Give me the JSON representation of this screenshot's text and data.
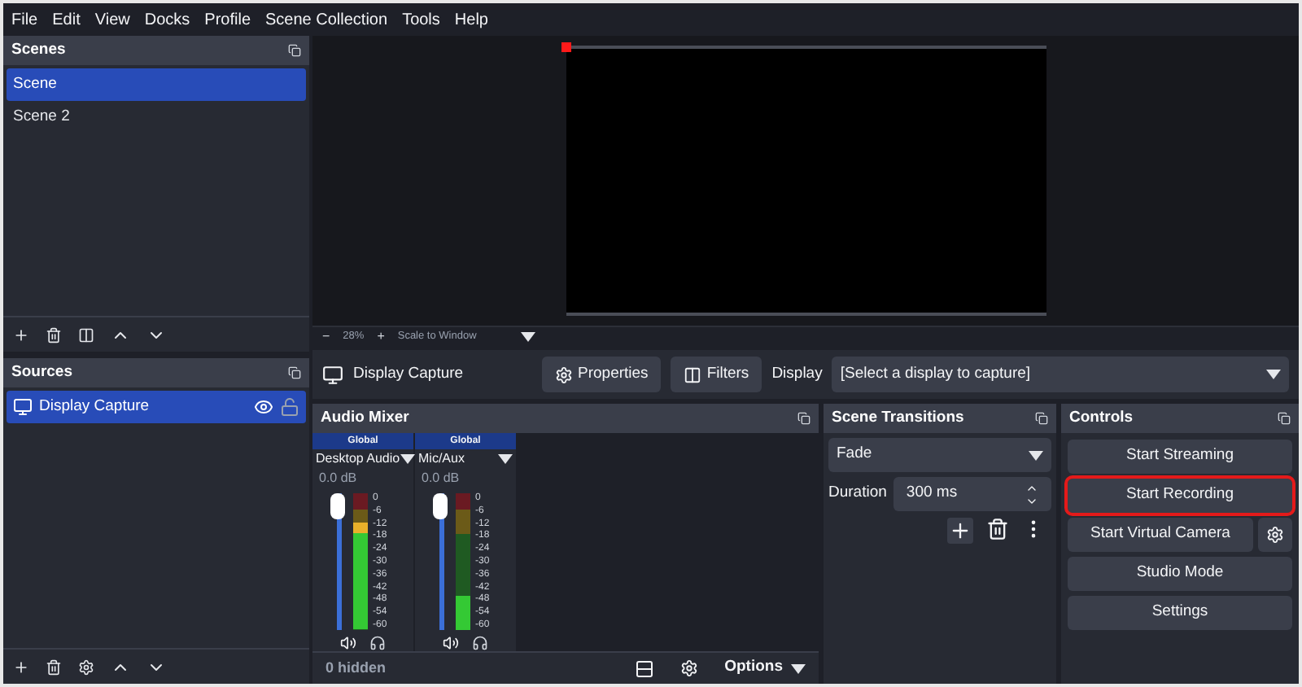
{
  "menu": [
    "File",
    "Edit",
    "View",
    "Docks",
    "Profile",
    "Scene Collection",
    "Tools",
    "Help"
  ],
  "scenes": {
    "title": "Scenes",
    "items": [
      {
        "label": "Scene",
        "selected": true
      },
      {
        "label": "Scene 2",
        "selected": false
      }
    ]
  },
  "sources": {
    "title": "Sources",
    "items": [
      {
        "label": "Display Capture",
        "selected": true,
        "visible": true,
        "locked": false
      }
    ]
  },
  "preview": {
    "zoom": "28%",
    "zoom_out": "−",
    "zoom_in": "+",
    "scale_mode": "Scale to Window"
  },
  "source_toolbar": {
    "source": "Display Capture",
    "properties": "Properties",
    "filters": "Filters",
    "display_label": "Display",
    "display_value": "[Select a display to capture]"
  },
  "audio_mixer": {
    "title": "Audio Mixer",
    "channels": [
      {
        "tag": "Global",
        "name": "Desktop Audio",
        "volume": "0.0 dB",
        "fader": {
          "level": 1
        },
        "meter": {
          "level": 0.78
        },
        "scale": [
          "0",
          "-6",
          "-12",
          "-18",
          "-24",
          "-30",
          "-36",
          "-42",
          "-48",
          "-54",
          "-60"
        ]
      },
      {
        "tag": "Global",
        "name": "Mic/Aux",
        "volume": "0.0 dB",
        "fader": {
          "level": 1
        },
        "meter": {
          "level": 0.25
        },
        "scale": [
          "0",
          "-6",
          "-12",
          "-18",
          "-24",
          "-30",
          "-36",
          "-42",
          "-48",
          "-54",
          "-60"
        ]
      }
    ],
    "hidden": "0 hidden",
    "options": "Options"
  },
  "scene_transitions": {
    "title": "Scene Transitions",
    "transition": "Fade",
    "duration_label": "Duration",
    "duration": "300 ms"
  },
  "controls": {
    "title": "Controls",
    "buttons": [
      {
        "label": "Start Streaming",
        "highlighted": false
      },
      {
        "label": "Start Recording",
        "highlighted": true
      },
      {
        "label": "Start Virtual Camera",
        "highlighted": false
      },
      {
        "label": "Studio Mode",
        "highlighted": false
      },
      {
        "label": "Settings",
        "highlighted": false
      }
    ]
  }
}
